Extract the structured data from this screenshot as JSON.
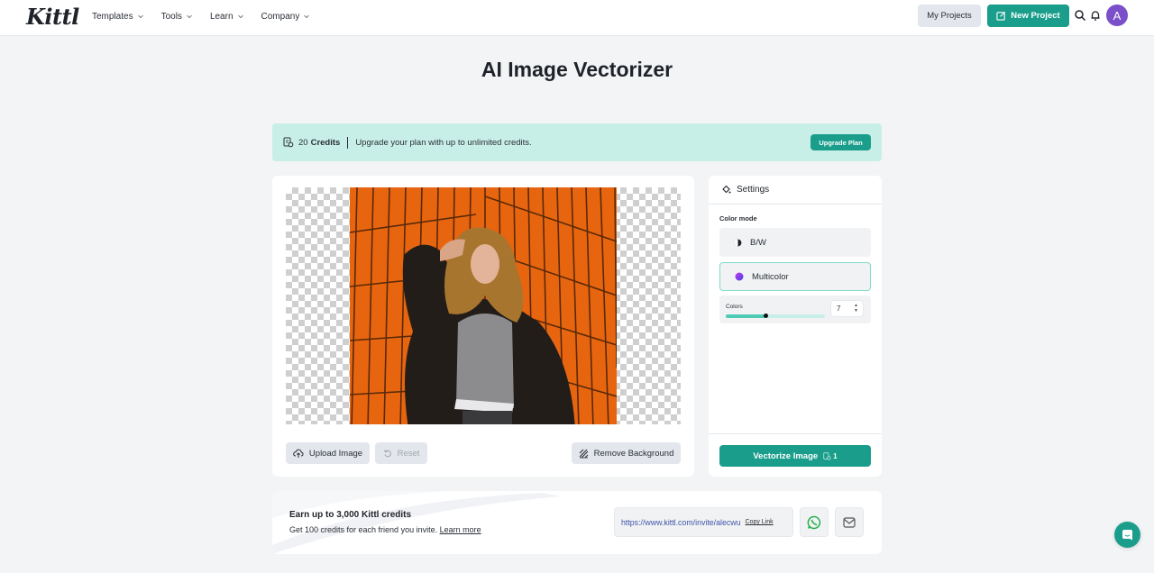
{
  "header": {
    "logo": "Kittl",
    "nav": [
      {
        "label": "Templates"
      },
      {
        "label": "Tools"
      },
      {
        "label": "Learn"
      },
      {
        "label": "Company"
      }
    ],
    "my_projects": "My Projects",
    "new_project": "New Project",
    "avatar_initial": "A",
    "icons": {
      "search": "search-icon",
      "notifications": "bell-icon",
      "new_project": "edit-square-icon"
    }
  },
  "page": {
    "title": "AI Image Vectorizer"
  },
  "credits_banner": {
    "credits_count": "20",
    "credits_label": "Credits",
    "message": "Upgrade your plan with up to unlimited credits.",
    "upgrade_button": "Upgrade Plan"
  },
  "image_panel": {
    "image_description": "Woman with long wavy hair in black leather jacket and grey top leaning against an orange tiled wall",
    "upload_button": "Upload Image",
    "reset_button": "Reset",
    "remove_bg_button": "Remove Background"
  },
  "settings": {
    "title": "Settings",
    "color_mode_label": "Color mode",
    "modes": [
      {
        "label": "B/W",
        "selected": false
      },
      {
        "label": "Multicolor",
        "selected": true
      }
    ],
    "colors_label": "Colors",
    "colors_value": "7",
    "colors_slider_fraction": 0.4,
    "vectorize_button": "Vectorize Image",
    "vectorize_cost": "1"
  },
  "referral": {
    "title": "Earn up to 3,000 Kittl credits",
    "subtitle": "Get 100 credits for each friend you invite.",
    "learn_more": "Learn more",
    "invite_url": "https://www.kittl.com/invite/alecwu",
    "copy_link": "Copy Link"
  },
  "colors": {
    "accent": "#1a9e8b",
    "banner_bg": "#c8efe7",
    "avatar": "#7b4fc9",
    "whatsapp": "#25b04a"
  }
}
